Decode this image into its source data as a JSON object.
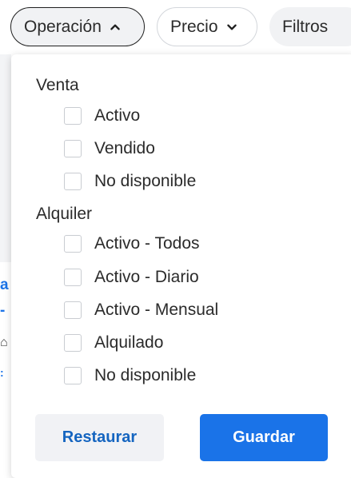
{
  "filter_bar": {
    "operacion_label": "Operación",
    "precio_label": "Precio",
    "filtros_label": "Filtros"
  },
  "dropdown": {
    "venta": {
      "title": "Venta",
      "options": [
        "Activo",
        "Vendido",
        "No disponible"
      ]
    },
    "alquiler": {
      "title": "Alquiler",
      "options": [
        "Activo - Todos",
        "Activo - Diario",
        "Activo - Mensual",
        "Alquilado",
        "No disponible"
      ]
    },
    "buttons": {
      "reset_label": "Restaurar",
      "save_label": "Guardar"
    }
  },
  "background": {
    "fragments": [
      "a u",
      "-",
      "⌂",
      ":"
    ]
  },
  "colors": {
    "accent": "#1a73e8",
    "link": "#1565c0",
    "pill_bg": "#f1f2f4"
  }
}
